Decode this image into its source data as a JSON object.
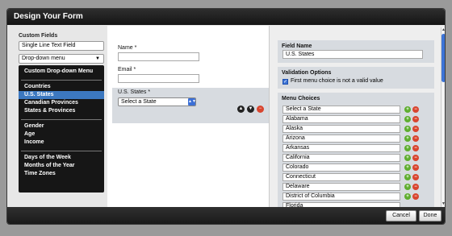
{
  "dialog": {
    "title": "Design Your Form"
  },
  "footer": {
    "cancel": "Cancel",
    "done": "Done"
  },
  "sidebar": {
    "heading": "Custom Fields",
    "single_line": "Single Line Text Field",
    "dropdown_selected": "Drop-down menu",
    "menu_items": [
      "Custom Drop-down Menu",
      "Countries",
      "U.S. States",
      "Canadian Provinces",
      "States & Provinces",
      "Gender",
      "Age",
      "Income",
      "Days of the Week",
      "Months of the Year",
      "Time Zones"
    ],
    "selected_item": "U.S. States"
  },
  "form": {
    "name_label": "Name *",
    "email_label": "Email *",
    "state_label": "U.S. States *",
    "state_select": "Select a State"
  },
  "props": {
    "field_name_label": "Field Name",
    "field_name_value": "U.S. States",
    "validation_label": "Validation Options",
    "validation_option": "First menu choice is not a valid value",
    "validation_checked": true,
    "menu_choices_label": "Menu Choices",
    "choices": [
      "Select a State",
      "Alabama",
      "Alaska",
      "Arizona",
      "Arkansas",
      "California",
      "Colorado",
      "Connecticut",
      "Delaware",
      "District of Columbia",
      "Florida"
    ]
  },
  "colors": {
    "selection": "#3c78c0",
    "add": "#5fae2f",
    "remove": "#d8452f",
    "titlebar": "#1e1e1e"
  }
}
